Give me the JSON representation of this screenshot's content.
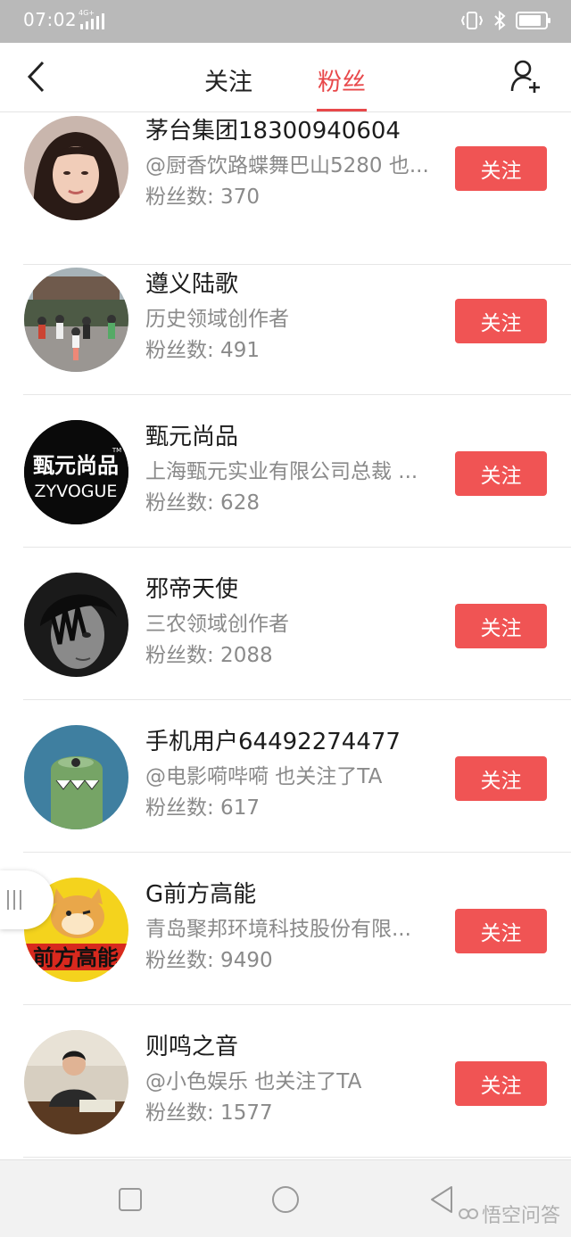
{
  "status_bar": {
    "time": "07:02",
    "network": "4G+"
  },
  "nav": {
    "tabs": [
      {
        "label": "关注",
        "active": false
      },
      {
        "label": "粉丝",
        "active": true
      }
    ],
    "accent_color": "#e8484a"
  },
  "fans": [
    {
      "name": "茅台集团18300940604",
      "description": "@厨香饮路蝶舞巴山5280 也...",
      "count": "粉丝数: 370",
      "follow_label": "关注",
      "avatar_icon": "woman-portrait"
    },
    {
      "name": "遵义陆歌",
      "description": "历史领域创作者",
      "count": "粉丝数: 491",
      "follow_label": "关注",
      "avatar_icon": "crowd-photo"
    },
    {
      "name": "甄元尚品",
      "description": "上海甄元实业有限公司总裁 ...",
      "count": "粉丝数: 628",
      "follow_label": "关注",
      "avatar_icon": "brand-logo",
      "avatar_text": "甄元尚品",
      "avatar_sub": "ZYVOGUE",
      "avatar_tm": "TM"
    },
    {
      "name": "邪帝天使",
      "description": "三农领域创作者",
      "count": "粉丝数: 2088",
      "follow_label": "关注",
      "avatar_icon": "dark-portrait"
    },
    {
      "name": "手机用户64492274477",
      "description": "@电影嗬哔嗬 也关注了TA",
      "count": "粉丝数: 617",
      "follow_label": "关注",
      "avatar_icon": "monster-cartoon"
    },
    {
      "name": "G前方高能",
      "description": "青岛聚邦环境科技股份有限...",
      "count": "粉丝数: 9490",
      "follow_label": "关注",
      "avatar_icon": "doge-cartoon",
      "avatar_text": "前方高能"
    },
    {
      "name": "则鸣之音",
      "description": "@小色娱乐 也关注了TA",
      "count": "粉丝数: 1577",
      "follow_label": "关注",
      "avatar_icon": "man-desk-photo"
    }
  ],
  "button_color": "#f05454",
  "watermark": "悟空问答"
}
